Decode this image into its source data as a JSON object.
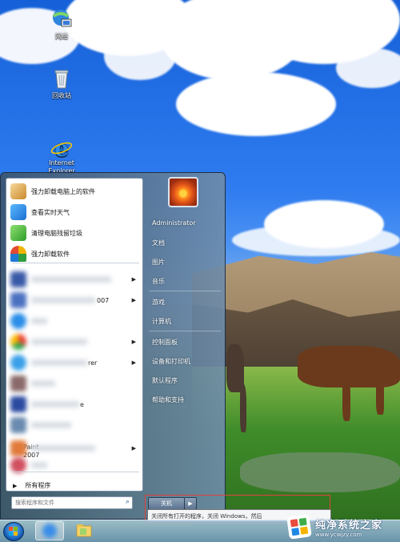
{
  "desktop": {
    "icons": [
      {
        "label": "网络",
        "icon": "network-icon"
      },
      {
        "label": "回收站",
        "icon": "recycle-bin-icon"
      },
      {
        "label": "Internet\nExplorer",
        "icon": "internet-explorer-icon"
      }
    ]
  },
  "start_menu": {
    "pinned": [
      {
        "label": "强力卸载电脑上的软件",
        "icon": "uninstall-box-icon"
      },
      {
        "label": "查看实时天气",
        "icon": "weather-icon"
      },
      {
        "label": "清理电脑残留垃圾",
        "icon": "cleanup-icon"
      },
      {
        "label": "强力卸载软件",
        "icon": "uninstall-shield-icon"
      }
    ],
    "recent": [
      {
        "label": "",
        "has_arrow": true
      },
      {
        "label": "007",
        "has_arrow": true
      },
      {
        "label": "",
        "has_arrow": false
      },
      {
        "label": "",
        "has_arrow": true
      },
      {
        "label": "rer",
        "has_arrow": true
      },
      {
        "label": "",
        "has_arrow": false
      },
      {
        "label": "e",
        "has_arrow": false
      },
      {
        "label": "",
        "has_arrow": false
      },
      {
        "label": "Paint\n2007",
        "has_arrow": true
      },
      {
        "label": "",
        "has_arrow": false
      }
    ],
    "all_programs": "所有程序",
    "search_placeholder": "搜索程序和文件",
    "user_name": "Administrator",
    "right_items": [
      "文档",
      "图片",
      "音乐",
      "游戏",
      "计算机",
      "控制面板",
      "设备和打印机",
      "默认程序",
      "帮助和支持"
    ],
    "shutdown_label": "关机",
    "shutdown_tooltip": "关闭所有打开的程序，关闭 Windows，然后"
  },
  "watermark": {
    "title": "纯净系统之家",
    "url": "www.ycwjzy.com",
    "colors": [
      "#e94b3c",
      "#3fae49",
      "#1e88e5",
      "#f6b400"
    ]
  }
}
